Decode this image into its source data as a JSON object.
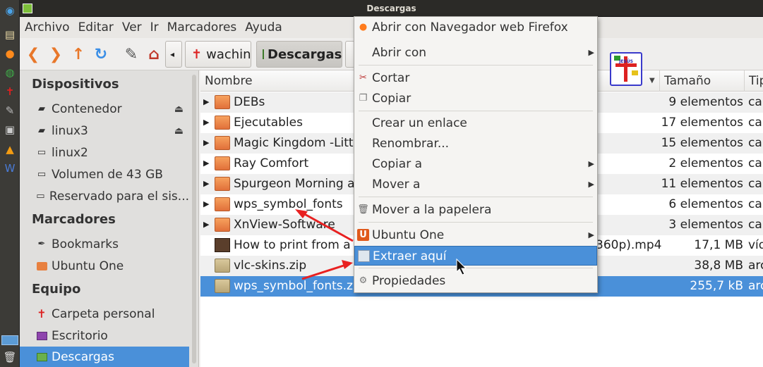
{
  "window": {
    "title": "Descargas"
  },
  "menubar": [
    "Archivo",
    "Editar",
    "Ver",
    "Ir",
    "Marcadores",
    "Ayuda"
  ],
  "toolbar": {
    "crumbs": [
      {
        "label": "wachin",
        "icon": "home-cross-icon"
      },
      {
        "label": "Descargas",
        "icon": "downloads-folder-icon",
        "selected": true
      }
    ]
  },
  "sidebar": {
    "sections": [
      {
        "title": "Dispositivos",
        "items": [
          {
            "label": "Contenedor",
            "icon": "usb-drive-icon",
            "eject": true
          },
          {
            "label": "linux3",
            "icon": "usb-drive-icon",
            "eject": true
          },
          {
            "label": "linux2",
            "icon": "hard-drive-icon"
          },
          {
            "label": "Volumen de 43 GB",
            "icon": "hard-drive-icon"
          },
          {
            "label": "Reservado para el sis...",
            "icon": "hard-drive-icon"
          }
        ]
      },
      {
        "title": "Marcadores",
        "items": [
          {
            "label": "Bookmarks",
            "icon": "feather-icon"
          },
          {
            "label": "Ubuntu One",
            "icon": "folder-icon"
          }
        ]
      },
      {
        "title": "Equipo",
        "items": [
          {
            "label": "Carpeta personal",
            "icon": "cross-icon"
          },
          {
            "label": "Escritorio",
            "icon": "desktop-icon"
          },
          {
            "label": "Descargas",
            "icon": "downloads-folder-icon",
            "selected": true
          }
        ]
      }
    ]
  },
  "columns": {
    "name": "Nombre",
    "size": "Tamaño",
    "type": "Tip"
  },
  "files": [
    {
      "name": "DEBs",
      "kind": "folder",
      "size": "9 elementos",
      "type": "ca"
    },
    {
      "name": "Ejecutables",
      "kind": "folder",
      "size": "17 elementos",
      "type": "ca"
    },
    {
      "name": "Magic Kingdom -Litt",
      "kind": "folder",
      "size": "15 elementos",
      "type": "ca"
    },
    {
      "name": "Ray Comfort",
      "kind": "folder",
      "size": "2 elementos",
      "type": "ca"
    },
    {
      "name": "Spurgeon Morning a",
      "kind": "folder",
      "size": "11 elementos",
      "type": "ca"
    },
    {
      "name": "wps_symbol_fonts",
      "kind": "folder",
      "size": "6 elementos",
      "type": "ca"
    },
    {
      "name": "XnView-Software",
      "kind": "folder",
      "size": "3 elementos",
      "type": "ca"
    },
    {
      "name": "How to print from a",
      "tail": "360p).mp4",
      "kind": "video",
      "size": "17,1 MB",
      "type": "víd"
    },
    {
      "name": "vlc-skins.zip",
      "kind": "zip",
      "size": "38,8 MB",
      "type": "arc"
    },
    {
      "name": "wps_symbol_fonts.zip",
      "kind": "zip",
      "size": "255,7 kB",
      "type": "arc",
      "selected": true
    }
  ],
  "context_menu": [
    {
      "label": "Abrir con Navegador web Firefox",
      "icon": "firefox-icon"
    },
    {
      "label": "Abrir con",
      "submenu": true
    },
    {
      "sep": true
    },
    {
      "label": "Cortar",
      "icon": "scissors-icon"
    },
    {
      "label": "Copiar",
      "icon": "copy-icon"
    },
    {
      "sep": true
    },
    {
      "label": "Crear un enlace"
    },
    {
      "label": "Renombrar..."
    },
    {
      "label": "Copiar a",
      "submenu": true
    },
    {
      "label": "Mover a",
      "submenu": true
    },
    {
      "sep": true
    },
    {
      "label": "Mover a la papelera",
      "icon": "trash-icon"
    },
    {
      "sep": true
    },
    {
      "label": "Ubuntu One",
      "icon": "ubuntu-one-icon",
      "submenu": true
    },
    {
      "label": "Extraer aquí",
      "icon": "archive-extract-icon",
      "highlighted": true
    },
    {
      "sep": true
    },
    {
      "label": "Propiedades",
      "icon": "gear-icon"
    }
  ],
  "logo": {
    "text": "JESÚS",
    "icon": "jesus-logo-icon"
  },
  "colors": {
    "selection": "#4a90d9",
    "folder": "#e8803f",
    "launcher": "#3c3b37"
  }
}
